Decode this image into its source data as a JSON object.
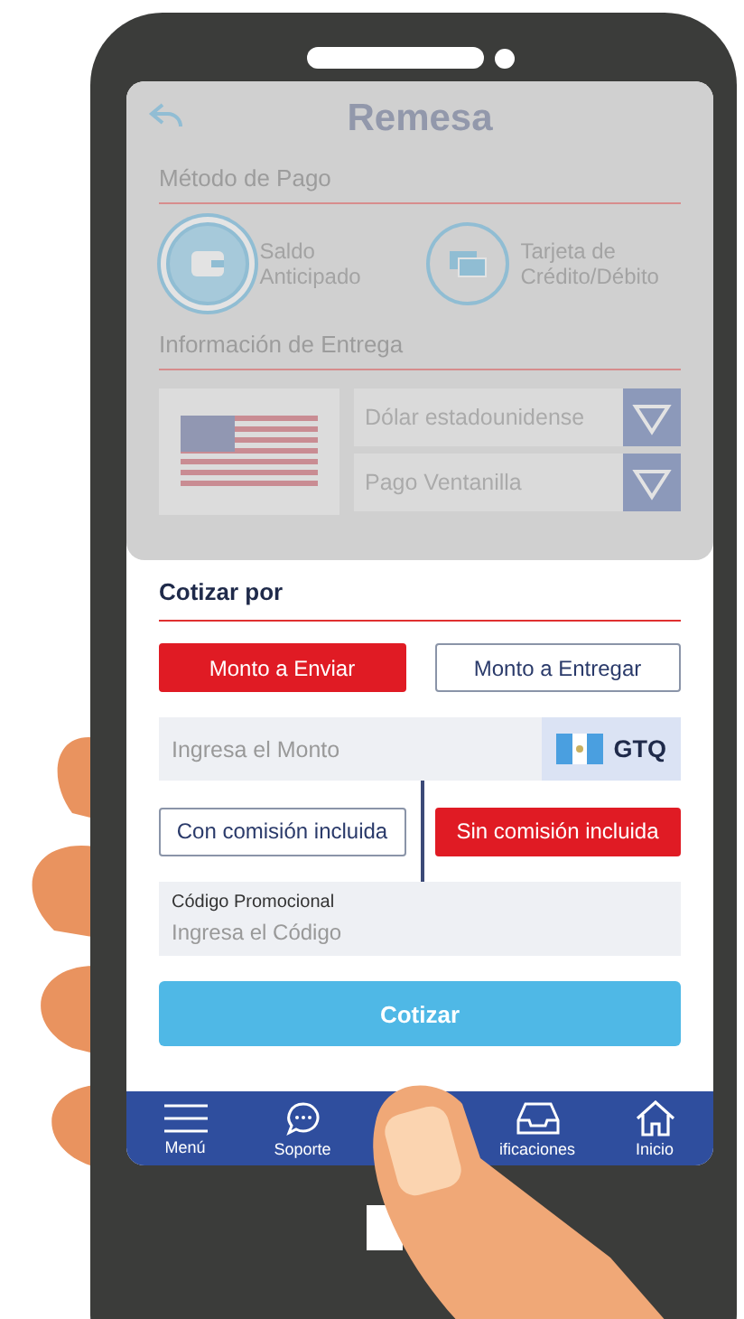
{
  "background_screen": {
    "dimmed": true,
    "title": "Remesa",
    "payment_section": "Método de Pago",
    "payment_methods": [
      {
        "label": "Saldo Anticipado",
        "kind": "wallet",
        "selected": true
      },
      {
        "label": "Tarjeta de Crédito/Débito",
        "kind": "card",
        "selected": false
      }
    ],
    "delivery_section": "Información de Entrega",
    "selects": [
      "Dólar estadounidense",
      "Pago Ventanilla"
    ]
  },
  "quote": {
    "title": "Cotizar por",
    "modes": [
      {
        "label": "Monto a Enviar",
        "selected": true
      },
      {
        "label": "Monto a Entregar",
        "selected": false
      }
    ],
    "amount": {
      "placeholder": "Ingresa el Monto",
      "currency": "GTQ"
    },
    "commission": [
      {
        "label": "Con comisión incluida",
        "selected": false
      },
      {
        "label": "Sin comisión incluida",
        "selected": true
      }
    ],
    "promo": {
      "label": "Código Promocional",
      "placeholder": "Ingresa el Código"
    },
    "submit": "Cotizar"
  },
  "nav": [
    {
      "label": "Menú",
      "kind": "menu"
    },
    {
      "label": "Soporte",
      "kind": "chat"
    },
    {
      "kind": "hidden"
    },
    {
      "label": "ificaciones",
      "kind": "inbox"
    },
    {
      "label": "Inicio",
      "kind": "home"
    }
  ]
}
